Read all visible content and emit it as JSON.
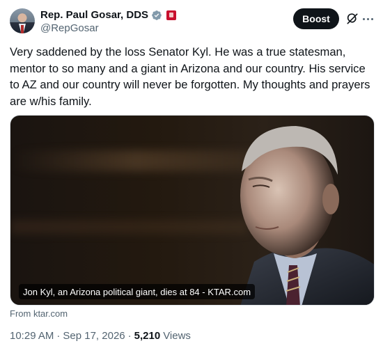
{
  "author": {
    "display_name": "Rep. Paul Gosar, DDS",
    "handle": "@RepGosar",
    "verified_badge_color": "#829aab",
    "gov_badge_color": "#c8102e"
  },
  "actions": {
    "boost_label": "Boost",
    "grok_icon": "grok-icon",
    "more_icon": "more-options-icon"
  },
  "tweet": {
    "text": "Very saddened by the loss Senator Kyl. He was a true statesman, mentor to so many and a giant in Arizona and our country.  His service to AZ and our country will never be forgotten.  My thoughts and prayers are w/his family."
  },
  "card": {
    "caption": "Jon Kyl, an Arizona political giant, dies at 84 - KTAR.com",
    "source": "From ktar.com"
  },
  "meta": {
    "time": "10:29 AM",
    "sep1": "·",
    "date": "Sep 17, 2026",
    "sep2": "·",
    "views_count": "5,210",
    "views_label": "Views"
  }
}
